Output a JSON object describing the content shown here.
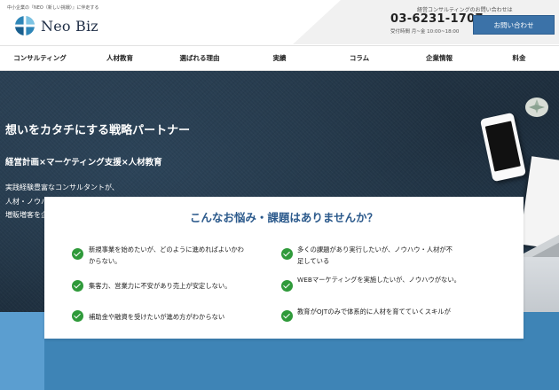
{
  "header": {
    "tagline": "中小企業の『NEO（新しい挑戦）』に伴走する",
    "logo_text": "Neo Biz",
    "phone_label": "経営コンサルティングのお問い合わせは",
    "phone_number": "03-6231-1707",
    "hours": "受付時間 月~金 10:00~18:00",
    "contact_button": "お問い合わせ"
  },
  "nav": {
    "items": [
      {
        "label": "コンサルティング"
      },
      {
        "label": "人材教育"
      },
      {
        "label": "選ばれる理由"
      },
      {
        "label": "実績"
      },
      {
        "label": "コラム"
      },
      {
        "label": "企業情報"
      },
      {
        "label": "料金"
      }
    ]
  },
  "hero": {
    "title": "想いをカタチにする戦略パートナー",
    "subtitle": "経営計画×マーケティング支援×人材教育",
    "description": [
      "実践経験豊富なコンサルタントが、",
      "人材・ノウハウ不足でお悩みの中小零細企業の経営者様に向けて、",
      "増販増客を企画から実行までワンストップで支援し、持続型経営へと導きます。"
    ]
  },
  "worries": {
    "title": "こんなお悩み・課題はありませんか？",
    "items": [
      {
        "lines": [
          "新規事業を始めたいが、どのように進めればよいかわ",
          "からない。"
        ]
      },
      {
        "lines": [
          "多くの課題があり実行したいが、ノウハウ・人材が不",
          "足している"
        ]
      },
      {
        "lines": [
          "集客力、営業力に不安があり売上が安定しない。"
        ]
      },
      {
        "lines": [
          "WEBマーケティングを実施したいが、ノウハウがない。"
        ]
      },
      {
        "lines": [
          "補助金や融資を受けたいが進め方がわからない"
        ]
      },
      {
        "lines": [
          "教育がOJTのみで体系的に人材を育てていくスキルが"
        ]
      }
    ]
  },
  "colors": {
    "accent": "#3b72a8",
    "title_blue": "#2c5a8c",
    "check_green": "#2f9a3a",
    "hero_dark": "#1d2d3c"
  }
}
